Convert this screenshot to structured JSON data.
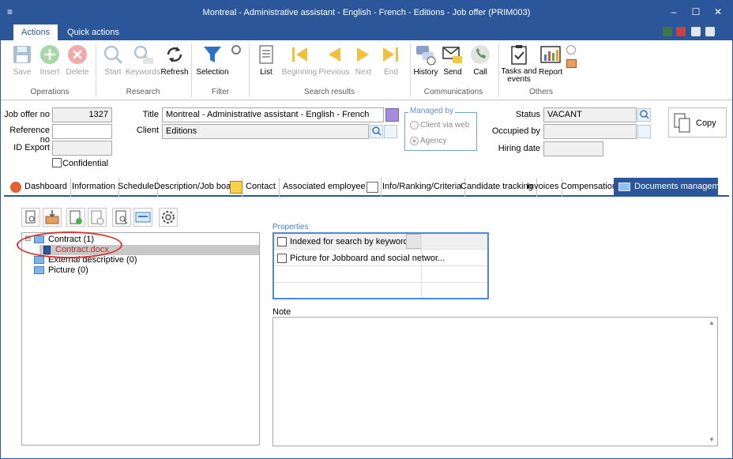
{
  "window": {
    "title": "Montreal - Administrative assistant - English - French - Editions - Job offer (PRIM003)",
    "controls": {
      "minimize": "–",
      "maximize": "☐",
      "close": "✕"
    },
    "menu_glyph": "≡"
  },
  "ribbon_tabs": [
    {
      "label": "Actions",
      "active": true
    },
    {
      "label": "Quick actions",
      "active": false
    }
  ],
  "ribbon": {
    "groups": {
      "operations": "Operations",
      "research": "Research",
      "filter": "Filter",
      "search_results": "Search results",
      "communications": "Communications",
      "others": "Others"
    },
    "buttons": {
      "save": "Save",
      "insert": "Insert",
      "delete": "Delete",
      "start": "Start",
      "keywords": "Keywords",
      "refresh": "Refresh",
      "selection": "Selection",
      "list": "List",
      "beginning": "Beginning",
      "previous": "Previous",
      "next": "Next",
      "end": "End",
      "history": "History",
      "send": "Send",
      "call": "Call",
      "tasks_events": "Tasks and events",
      "report": "Report"
    }
  },
  "form": {
    "job_offer_no_label": "Job offer no",
    "job_offer_no": "1327",
    "reference_no_label": "Reference no",
    "reference_no": "",
    "id_export_label": "ID Export",
    "id_export": "",
    "confidential_label": "Confidential",
    "title_label": "Title",
    "title": "Montreal - Administrative assistant - English - French",
    "client_label": "Client",
    "client": "Editions",
    "managed_by_label": "Managed by",
    "managed_options": [
      "Client via web",
      "Agency"
    ],
    "managed_selected": "Agency",
    "status_label": "Status",
    "status": "VACANT",
    "occupied_by_label": "Occupied by",
    "occupied_by": "",
    "hiring_date_label": "Hiring date",
    "hiring_date": "",
    "copy_label": "Copy"
  },
  "section_tabs": [
    {
      "label": "Dashboard",
      "active": false
    },
    {
      "label": "Information",
      "active": false
    },
    {
      "label": "Schedule",
      "active": false
    },
    {
      "label": "Description/Job board",
      "active": false
    },
    {
      "label": "Contact",
      "active": false
    },
    {
      "label": "Associated employee (s)",
      "active": false
    },
    {
      "label": "Info/Ranking/Criteria",
      "active": false
    },
    {
      "label": "Candidate tracking",
      "active": false
    },
    {
      "label": "Invoices",
      "active": false
    },
    {
      "label": "Compensations",
      "active": false
    },
    {
      "label": "Documents management",
      "active": true
    }
  ],
  "documents": {
    "tree": [
      {
        "label": "Contract (1)",
        "level": 0,
        "expanded": true
      },
      {
        "label": "Contract.docx",
        "level": 1,
        "selected": true
      },
      {
        "label": "External descriptive (0)",
        "level": 0
      },
      {
        "label": "Picture (0)",
        "level": 0
      }
    ],
    "expander_glyph": "⊟",
    "properties_label": "Properties",
    "properties": [
      {
        "label": "Indexed for search by keywords",
        "checked": false
      },
      {
        "label": "Picture for Jobboard and social networ...",
        "checked": false
      }
    ],
    "note_label": "Note",
    "note": ""
  },
  "colors": {
    "accent": "#2b579a",
    "highlight": "#d93434",
    "selection": "#c8c8c8"
  }
}
